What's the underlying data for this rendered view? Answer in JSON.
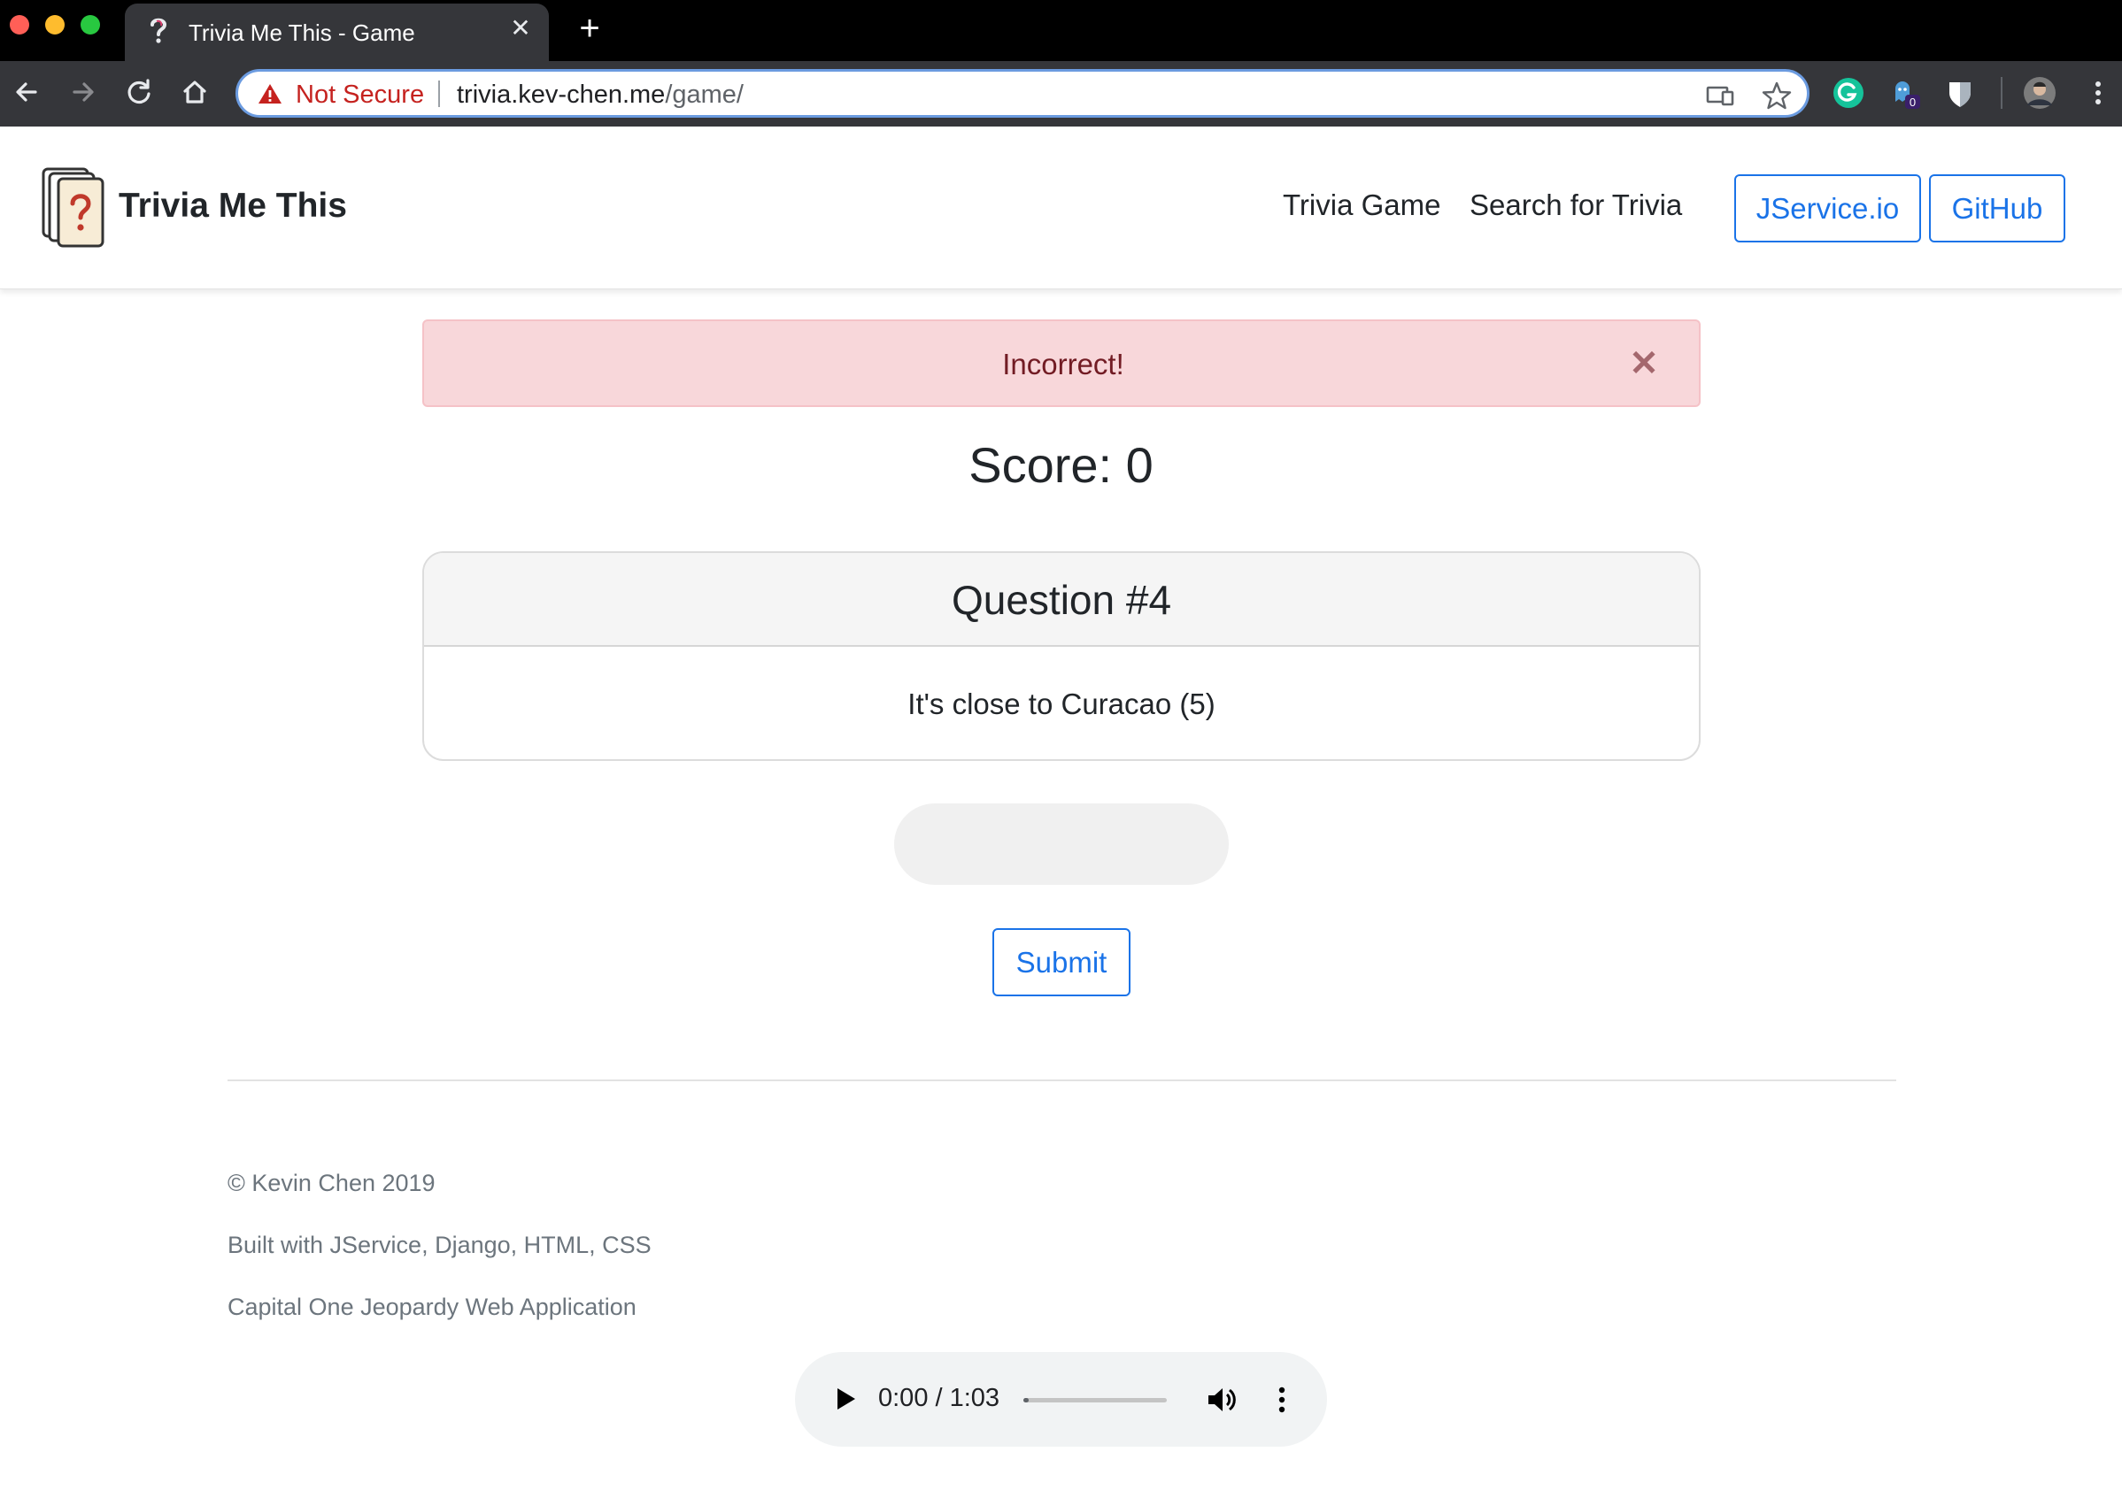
{
  "browser": {
    "tab_title": "Trivia Me This - Game",
    "tab_close": "✕",
    "new_tab": "+",
    "not_secure": "Not Secure",
    "url_host": "trivia.kev-chen.me",
    "url_path": "/game/",
    "extension_badge": "0",
    "icons": [
      "back-icon",
      "forward-icon",
      "reload-icon",
      "home-icon",
      "warning-icon",
      "cast-icon",
      "star-icon",
      "grammarly-icon",
      "ghostery-icon",
      "bitwarden-icon",
      "profile-avatar",
      "menu-icon"
    ]
  },
  "navbar": {
    "brand": "Trivia Me This",
    "links": [
      "Trivia Game",
      "Search for Trivia"
    ],
    "buttons": [
      "JService.io",
      "GitHub"
    ]
  },
  "alert": {
    "message": "Incorrect!",
    "close": "✕"
  },
  "game": {
    "score_label": "Score: 0",
    "question_title": "Question #4",
    "question_text": "It's close to Curacao (5)",
    "answer_value": "",
    "submit_label": "Submit"
  },
  "footer": {
    "lines": [
      "© Kevin Chen 2019",
      "Built with JService, Django, HTML, CSS",
      "Capital One Jeopardy Web Application"
    ]
  },
  "audio": {
    "time": "0:00 / 1:03",
    "progress": 0
  },
  "colors": {
    "accent": "#1a73e8",
    "alert_bg": "#f8d7da",
    "alert_text": "#721c24",
    "not_secure": "#c5221f"
  }
}
